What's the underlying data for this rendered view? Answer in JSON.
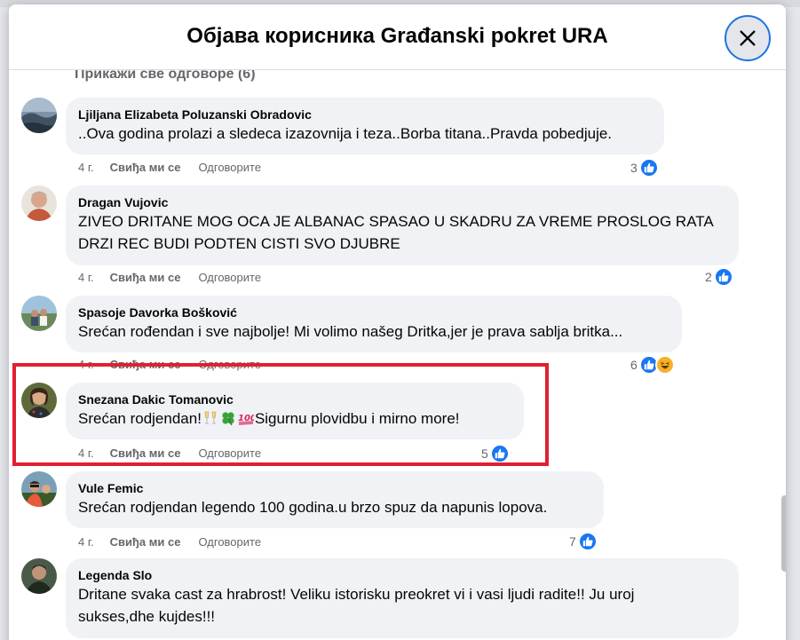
{
  "modal": {
    "title": "Објава корисника Građanski pokret URA",
    "close_icon": "close-icon"
  },
  "thread": {
    "show_replies_label": "Прикажи све одговоре (6)"
  },
  "colors": {
    "like_blue": "#1877f2",
    "highlight_red": "#e02030",
    "bubble_bg": "#f0f2f5",
    "secondary_text": "#65676b"
  },
  "comments": [
    {
      "author": "Ljiljana Elizabeta Poluzanski Obradovic",
      "text": "..Ova godina prolazi a sledeca izazovnija i teza..Borba titana..Pravda pobedjuje.",
      "time": "4 г.",
      "like_label": "Свиђа ми се",
      "reply_label": "Одговорите",
      "reaction_count": "3",
      "reactions": [
        "like"
      ]
    },
    {
      "author": "Dragan Vujovic",
      "text": "ZIVEO DRITANE MOG OCA JE ALBANAC SPASAO U SKADRU ZA VREME PROSLOG RATA\nDRZI REC BUDI PODTEN CISTI SVO DJUBRE",
      "time": "4 г.",
      "like_label": "Свиђа ми се",
      "reply_label": "Одговорите",
      "reaction_count": "2",
      "reactions": [
        "like"
      ]
    },
    {
      "author": "Spasoje Davorka Bošković",
      "text": "Srećan rođendan i sve najbolje! Mi volimo našeg Dritka,jer je prava sablja britka...",
      "time": "4 г.",
      "like_label": "Свиђа ми се",
      "reply_label": "Одговорите",
      "reaction_count": "6",
      "reactions": [
        "like",
        "haha"
      ]
    },
    {
      "author": "Snezana Dakic Tomanovic",
      "text_before": "Srećan rodjendan!",
      "text_after": "Sigurnu plovidbu i mirno more!",
      "emojis": [
        "clinking-glasses-emoji",
        "four-leaf-clover-emoji",
        "hundred-points-emoji"
      ],
      "time": "4 г.",
      "like_label": "Свиђа ми се",
      "reply_label": "Одговорите",
      "reaction_count": "5",
      "reactions": [
        "like"
      ]
    },
    {
      "author": "Vule Femic",
      "text": "Srećan rodjendan legendo 100 godina.u brzo spuz da napunis lopova.",
      "time": "4 г.",
      "like_label": "Свиђа ми се",
      "reply_label": "Одговорите",
      "reaction_count": "7",
      "reactions": [
        "like"
      ]
    },
    {
      "author": "Legenda Slo",
      "text": "Dritane svaka cast za hrabrost! Veliku istorisku preokret vi i vasi ljudi radite!! Ju uroj\nsukses,dhe kujdes!!!",
      "time": "",
      "like_label": "",
      "reply_label": "",
      "reaction_count": "",
      "reactions": []
    }
  ]
}
